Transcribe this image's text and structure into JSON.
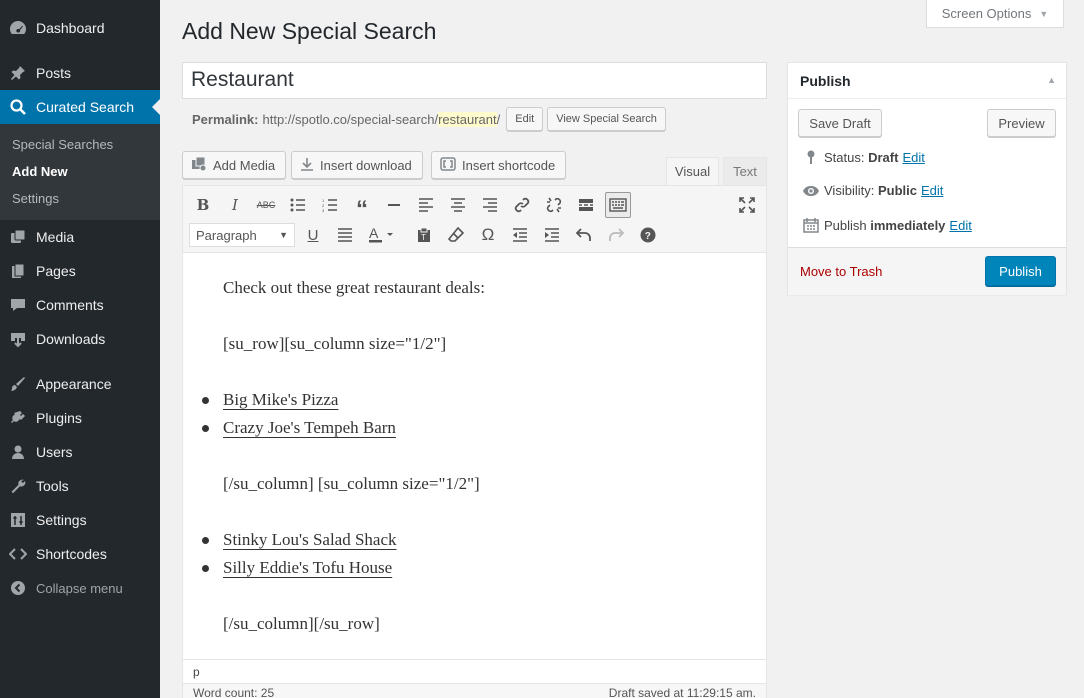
{
  "sidebar": {
    "items": [
      {
        "label": "Dashboard",
        "icon": "dashboard-icon"
      },
      {
        "label": "Posts",
        "icon": "pin-icon"
      },
      {
        "label": "Curated Search",
        "icon": "search-icon"
      },
      {
        "label": "Media",
        "icon": "media-icon"
      },
      {
        "label": "Pages",
        "icon": "pages-icon"
      },
      {
        "label": "Comments",
        "icon": "comments-icon"
      },
      {
        "label": "Downloads",
        "icon": "download-icon"
      },
      {
        "label": "Appearance",
        "icon": "brush-icon"
      },
      {
        "label": "Plugins",
        "icon": "plugin-icon"
      },
      {
        "label": "Users",
        "icon": "user-icon"
      },
      {
        "label": "Tools",
        "icon": "wrench-icon"
      },
      {
        "label": "Settings",
        "icon": "settings-icon"
      },
      {
        "label": "Shortcodes",
        "icon": "code-icon"
      }
    ],
    "submenu": [
      "Special Searches",
      "Add New",
      "Settings"
    ],
    "collapse": "Collapse menu",
    "accent": "#0073aa"
  },
  "screen_options": "Screen Options",
  "page_title": "Add New Special Search",
  "title_value": "Restaurant",
  "permalink": {
    "label": "Permalink:",
    "url_prefix": "http://spotlo.co/special-search/",
    "slug": "restaurant",
    "suffix": "/",
    "edit_label": "Edit",
    "view_label": "View Special Search"
  },
  "media_buttons": [
    "Add Media",
    "Insert download",
    "Insert shortcode"
  ],
  "editor_tabs": [
    "Visual",
    "Text"
  ],
  "format_select": "Paragraph",
  "content": {
    "intro": "Check out these great restaurant deals:",
    "row_open": "[su_row][su_column size=\"1/2\"]",
    "list1": [
      "Big Mike's Pizza",
      "Crazy Joe's Tempeh Barn"
    ],
    "col_sep": "[/su_column] [su_column size=\"1/2\"]",
    "list2": [
      "Stinky Lou's Salad Shack",
      "Silly Eddie's Tofu House"
    ],
    "row_close": "[/su_column][/su_row]"
  },
  "status_path": "p",
  "word_count": "Word count: 25",
  "draft_saved": "Draft saved at 11:29:15 am.",
  "publish": {
    "title": "Publish",
    "save_draft": "Save Draft",
    "preview": "Preview",
    "status_label": "Status:",
    "status_value": "Draft",
    "visibility_label": "Visibility:",
    "visibility_value": "Public",
    "publish_label": "Publish",
    "publish_value": "immediately",
    "edit": "Edit",
    "trash": "Move to Trash",
    "publish_button": "Publish",
    "button_color": "#0085ba"
  }
}
